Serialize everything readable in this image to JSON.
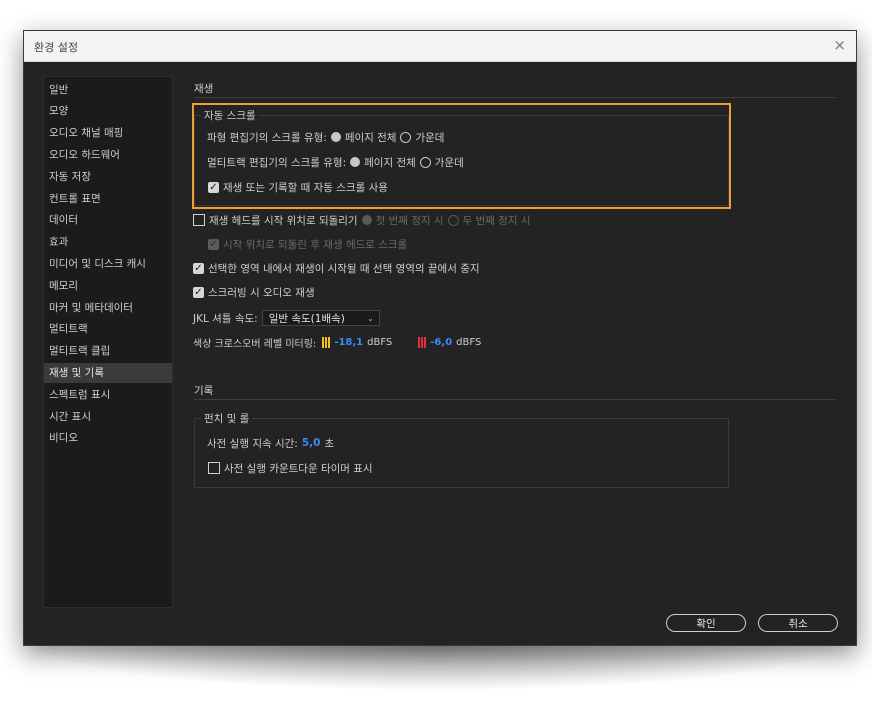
{
  "window": {
    "title": "환경 설정",
    "close_glyph": "×"
  },
  "sidebar": {
    "items": [
      {
        "label": "일반"
      },
      {
        "label": "모양"
      },
      {
        "label": "오디오 채널 매핑"
      },
      {
        "label": "오디오 하드웨어"
      },
      {
        "label": "자동 저장"
      },
      {
        "label": "컨트롤 표면"
      },
      {
        "label": "데이터"
      },
      {
        "label": "효과"
      },
      {
        "label": "미디어 및 디스크 캐시"
      },
      {
        "label": "메모리"
      },
      {
        "label": "마커 및 메타데이터"
      },
      {
        "label": "멀티트랙"
      },
      {
        "label": "멀티트랙 클립"
      },
      {
        "label": "재생 및 기록",
        "selected": true
      },
      {
        "label": "스펙트럼 표시"
      },
      {
        "label": "시간 표시"
      },
      {
        "label": "비디오"
      }
    ]
  },
  "playback": {
    "title": "재생",
    "autoscroll": {
      "legend": "자동 스크롤",
      "waveform_label": "파형 편집기의 스크롤 유형:",
      "multitrack_label": "멀티트랙 편집기의 스크롤 유형:",
      "option_page": "페이지 전체",
      "option_center": "가운데",
      "enable_label": "재생 또는 기록할 때 자동 스크롤 사용"
    },
    "return_playhead": {
      "label": "재생 헤드를 시작 위치로 되돌리기",
      "option_first": "첫 번째 정지 시",
      "option_second": "두 번째 정지 시"
    },
    "stop_playhead_label": "시작 위치로 되돌린 후 재생 헤드로 스크롤",
    "stop_at_selection_label": "선택한 영역 내에서 재생이 시작될 때 선택 영역의 끝에서 중지",
    "scrub_audio_label": "스크러빙 시 오디오 재생",
    "jkl": {
      "label": "JKL 셔틀 속도:",
      "value": "일반 속도(1배속)"
    },
    "crossover": {
      "label": "색상 크로스오버 레벨 미터링:",
      "yellow_value": "-18,1",
      "red_value": "-6,0",
      "unit": "dBFS",
      "yellow_color": "#f2c21b",
      "red_color": "#e0323a",
      "value_color": "#3b8bf5"
    }
  },
  "recording": {
    "title": "기록",
    "punch": {
      "legend": "펀치 및 롤",
      "preroll_label": "사전 실행 지속 시간:",
      "preroll_value": "5,0",
      "preroll_unit": "초",
      "countdown_label": "사전 실행 카운트다운 타이머 표시"
    }
  },
  "buttons": {
    "ok": "확인",
    "cancel": "취소"
  },
  "colors": {
    "highlight": "#f0a030",
    "background": "#232323"
  }
}
